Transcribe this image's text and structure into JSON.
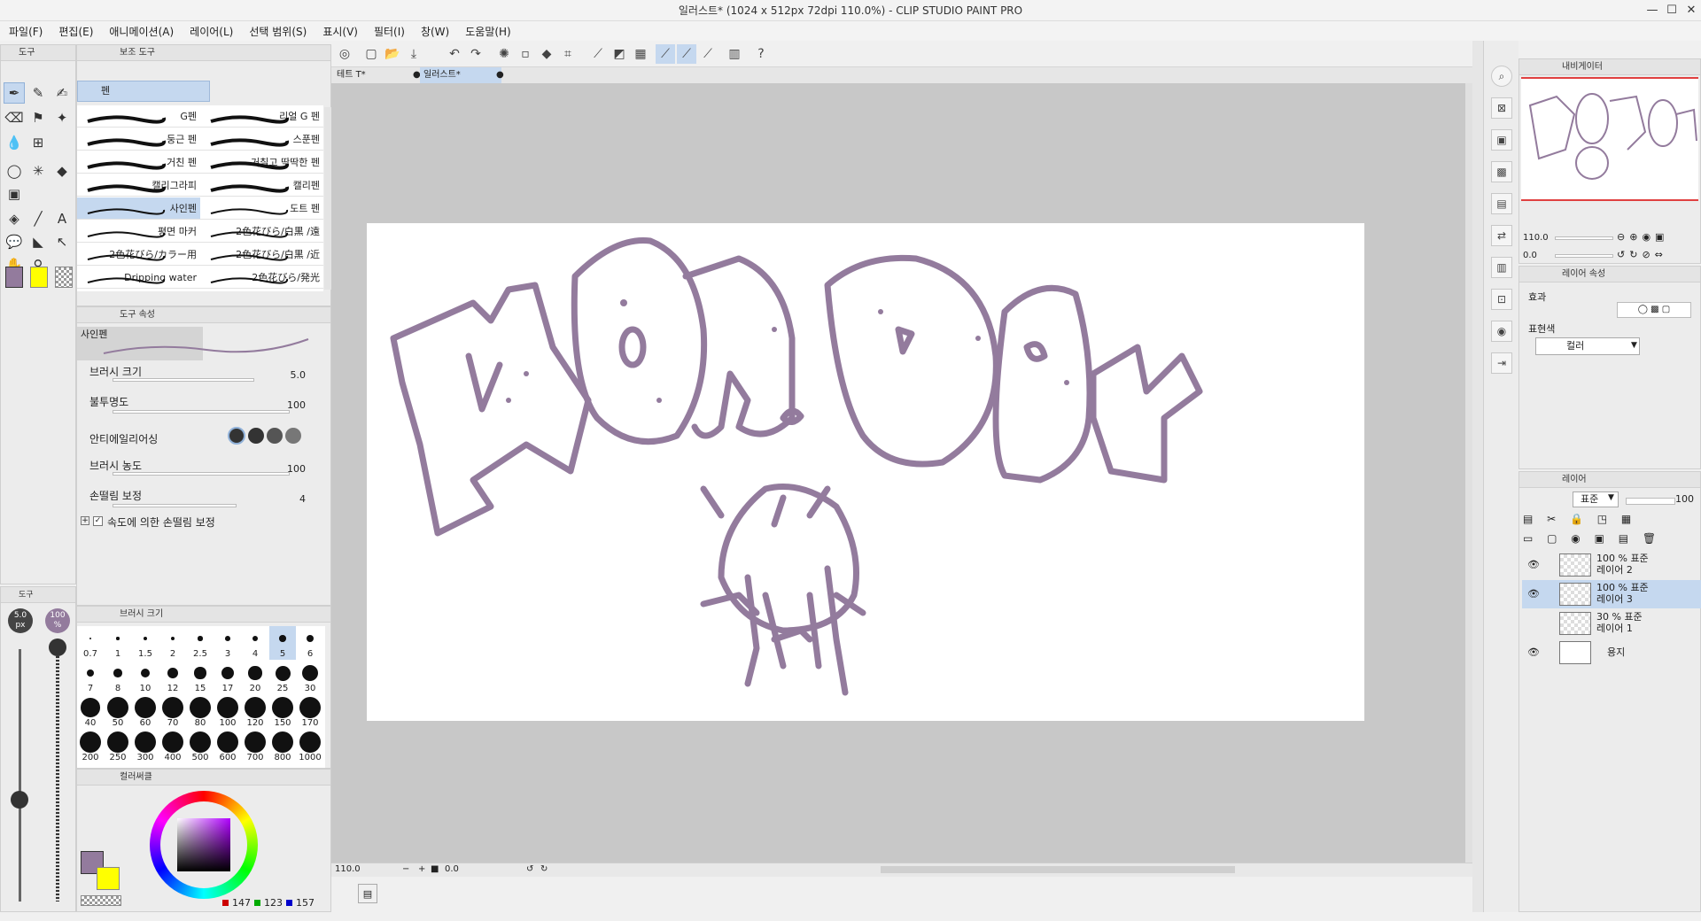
{
  "window": {
    "title": "일러스트* (1024 x 512px 72dpi 110.0%) - CLIP STUDIO PAINT PRO"
  },
  "menu": [
    "파일(F)",
    "편집(E)",
    "애니메이션(A)",
    "레이어(L)",
    "선택 범위(S)",
    "표시(V)",
    "필터(I)",
    "창(W)",
    "도움말(H)"
  ],
  "panels": {
    "tool_tab": "도구",
    "subtool_tab": "보조 도구",
    "subtool_group": "펜",
    "tool_prop_tab": "도구 속성",
    "brush_size_tab": "브러시 크기",
    "color_tab": "컬러써클",
    "navigator_tab": "내비게이터",
    "layer_prop_tab": "레이어 속성",
    "layer_tab": "레이어"
  },
  "brushes": [
    {
      "left": "G펜",
      "right": "리얼 G 펜"
    },
    {
      "left": "둥근 펜",
      "right": "스푼펜"
    },
    {
      "left": "거친 펜",
      "right": "거칠고 딱딱한 펜"
    },
    {
      "left": "캘리그라피",
      "right": "캘리펜"
    },
    {
      "left": "사인펜",
      "right": "도트 펜"
    },
    {
      "left": "평면 마커",
      "right": "2色花びら/白黒 /遠"
    },
    {
      "left": "2色花びら/カラー用",
      "right": "2色花びら/白黒 /近"
    },
    {
      "left": "Dripping water",
      "right": "2色花びら/発光"
    }
  ],
  "tool_props": {
    "tool_name": "사인펜",
    "brush_size_label": "브러시 크기",
    "brush_size_value": "5.0",
    "opacity_label": "불투명도",
    "opacity_value": "100",
    "antialias_label": "안티에일리어싱",
    "density_label": "브러시 농도",
    "density_value": "100",
    "stabilization_label": "손떨림 보정",
    "stabilization_value": "4",
    "speed_stab_label": "속도에 의한 손떨림 보정"
  },
  "left_slider": {
    "size": "5.0",
    "size_unit": "px",
    "opacity": "100",
    "opacity_unit": "%"
  },
  "brush_sizes": [
    "0.7",
    "1",
    "1.5",
    "2",
    "2.5",
    "3",
    "4",
    "5",
    "6",
    "7",
    "8",
    "10",
    "12",
    "15",
    "17",
    "20",
    "25",
    "30",
    "40",
    "50",
    "60",
    "70",
    "80",
    "100",
    "120",
    "150",
    "170",
    "200",
    "250",
    "300",
    "400",
    "500",
    "600",
    "700",
    "800",
    "1000"
  ],
  "selected_brush_size": "5",
  "color": {
    "r": "147",
    "g": "123",
    "b": "157",
    "main": "#937b9d",
    "sub": "#ffff00"
  },
  "tabs": {
    "tab1": "테트 T*",
    "tab2": "일러스트*"
  },
  "status": {
    "zoom": "110.0",
    "rotate": "0.0"
  },
  "navigator": {
    "zoom": "110.0",
    "rotate": "0.0"
  },
  "layer_prop": {
    "effect_label": "효과",
    "express_label": "표현색",
    "express_value": "컬러"
  },
  "layer_panel": {
    "blend": "표준",
    "opacity": "100"
  },
  "layers": [
    {
      "info": "100 % 표준",
      "name": "레이어 2"
    },
    {
      "info": "100 % 표준",
      "name": "레이어 3"
    },
    {
      "info": "30 % 표준",
      "name": "레이어 1"
    },
    {
      "info": "",
      "name": "용지"
    }
  ]
}
